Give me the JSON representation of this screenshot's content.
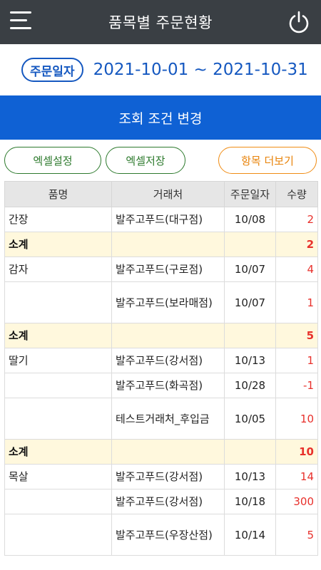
{
  "header": {
    "title": "품목별 주문현황",
    "menu_icon": "hamburger-menu-icon",
    "power_icon": "power-icon"
  },
  "filter": {
    "date_label": "주문일자",
    "date_range": "2021-10-01 ~ 2021-10-31"
  },
  "condition_button": "조회 조건 변경",
  "actions": {
    "excel_settings": "엑셀설정",
    "excel_save": "엑셀저장",
    "more_columns": "항목 더보기"
  },
  "colors": {
    "header_bg": "#3a3f44",
    "accent_blue": "#0f61d4",
    "green": "#2d7a2d",
    "orange": "#f08c14",
    "qty_red": "#e8302b",
    "subtotal_bg": "#fff8dd"
  },
  "table": {
    "columns": [
      "품명",
      "거래처",
      "주문일자",
      "수량"
    ],
    "rows": [
      {
        "type": "item",
        "name": "간장",
        "vendor": "발주고푸드(대구점)",
        "date": "10/08",
        "qty": "2"
      },
      {
        "type": "subtotal",
        "name": "소계",
        "vendor": "",
        "date": "",
        "qty": "2"
      },
      {
        "type": "item",
        "name": "감자",
        "vendor": "발주고푸드(구로점)",
        "date": "10/07",
        "qty": "4"
      },
      {
        "type": "item",
        "name": "",
        "vendor": "발주고푸드(보라매점)",
        "date": "10/07",
        "qty": "1"
      },
      {
        "type": "subtotal",
        "name": "소계",
        "vendor": "",
        "date": "",
        "qty": "5"
      },
      {
        "type": "item",
        "name": "딸기",
        "vendor": "발주고푸드(강서점)",
        "date": "10/13",
        "qty": "1"
      },
      {
        "type": "item",
        "name": "",
        "vendor": "발주고푸드(화곡점)",
        "date": "10/28",
        "qty": "-1"
      },
      {
        "type": "item",
        "name": "",
        "vendor": "테스트거래처_후입금",
        "date": "10/05",
        "qty": "10"
      },
      {
        "type": "subtotal",
        "name": "소계",
        "vendor": "",
        "date": "",
        "qty": "10"
      },
      {
        "type": "item",
        "name": "목살",
        "vendor": "발주고푸드(강서점)",
        "date": "10/13",
        "qty": "14"
      },
      {
        "type": "item",
        "name": "",
        "vendor": "발주고푸드(강서점)",
        "date": "10/18",
        "qty": "300"
      },
      {
        "type": "item",
        "name": "",
        "vendor": "발주고푸드(우장산점)",
        "date": "10/14",
        "qty": "5"
      }
    ]
  }
}
